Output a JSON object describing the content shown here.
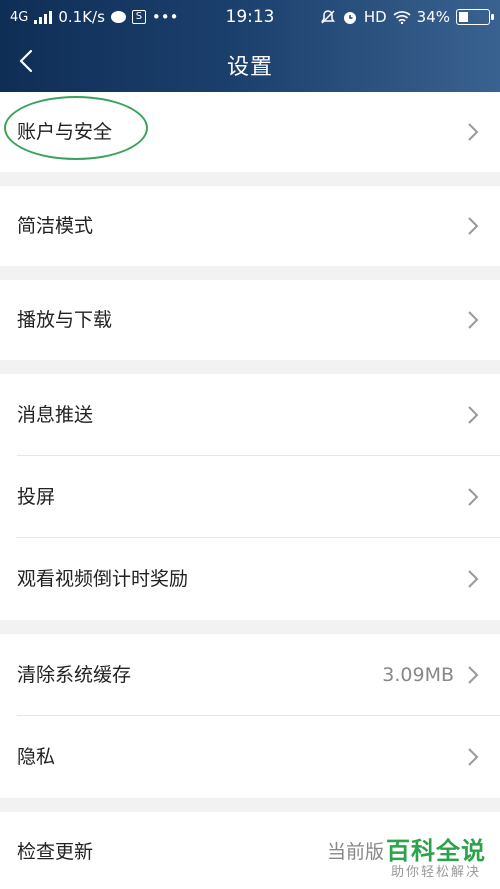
{
  "status_bar": {
    "network": "4G",
    "speed": "0.1K/s",
    "time": "19:13",
    "hd": "HD",
    "battery": "34%",
    "battery_level": 0.34
  },
  "header": {
    "title": "设置"
  },
  "settings": [
    {
      "label": "账户与安全"
    },
    {
      "label": "简洁模式"
    },
    {
      "label": "播放与下载"
    },
    {
      "label": "消息推送"
    },
    {
      "label": "投屏"
    },
    {
      "label": "观看视频倒计时奖励"
    },
    {
      "label": "清除系统缓存",
      "value": "3.09MB"
    },
    {
      "label": "隐私"
    },
    {
      "label": "检查更新",
      "value": "当前版"
    }
  ],
  "watermark": {
    "title": "百科全说",
    "subtitle": "助你轻松解决"
  },
  "colors": {
    "header_start": "#0f2e56",
    "header_end": "#3a6290",
    "highlight": "#3aa35a",
    "watermark": "#2aa34a"
  }
}
